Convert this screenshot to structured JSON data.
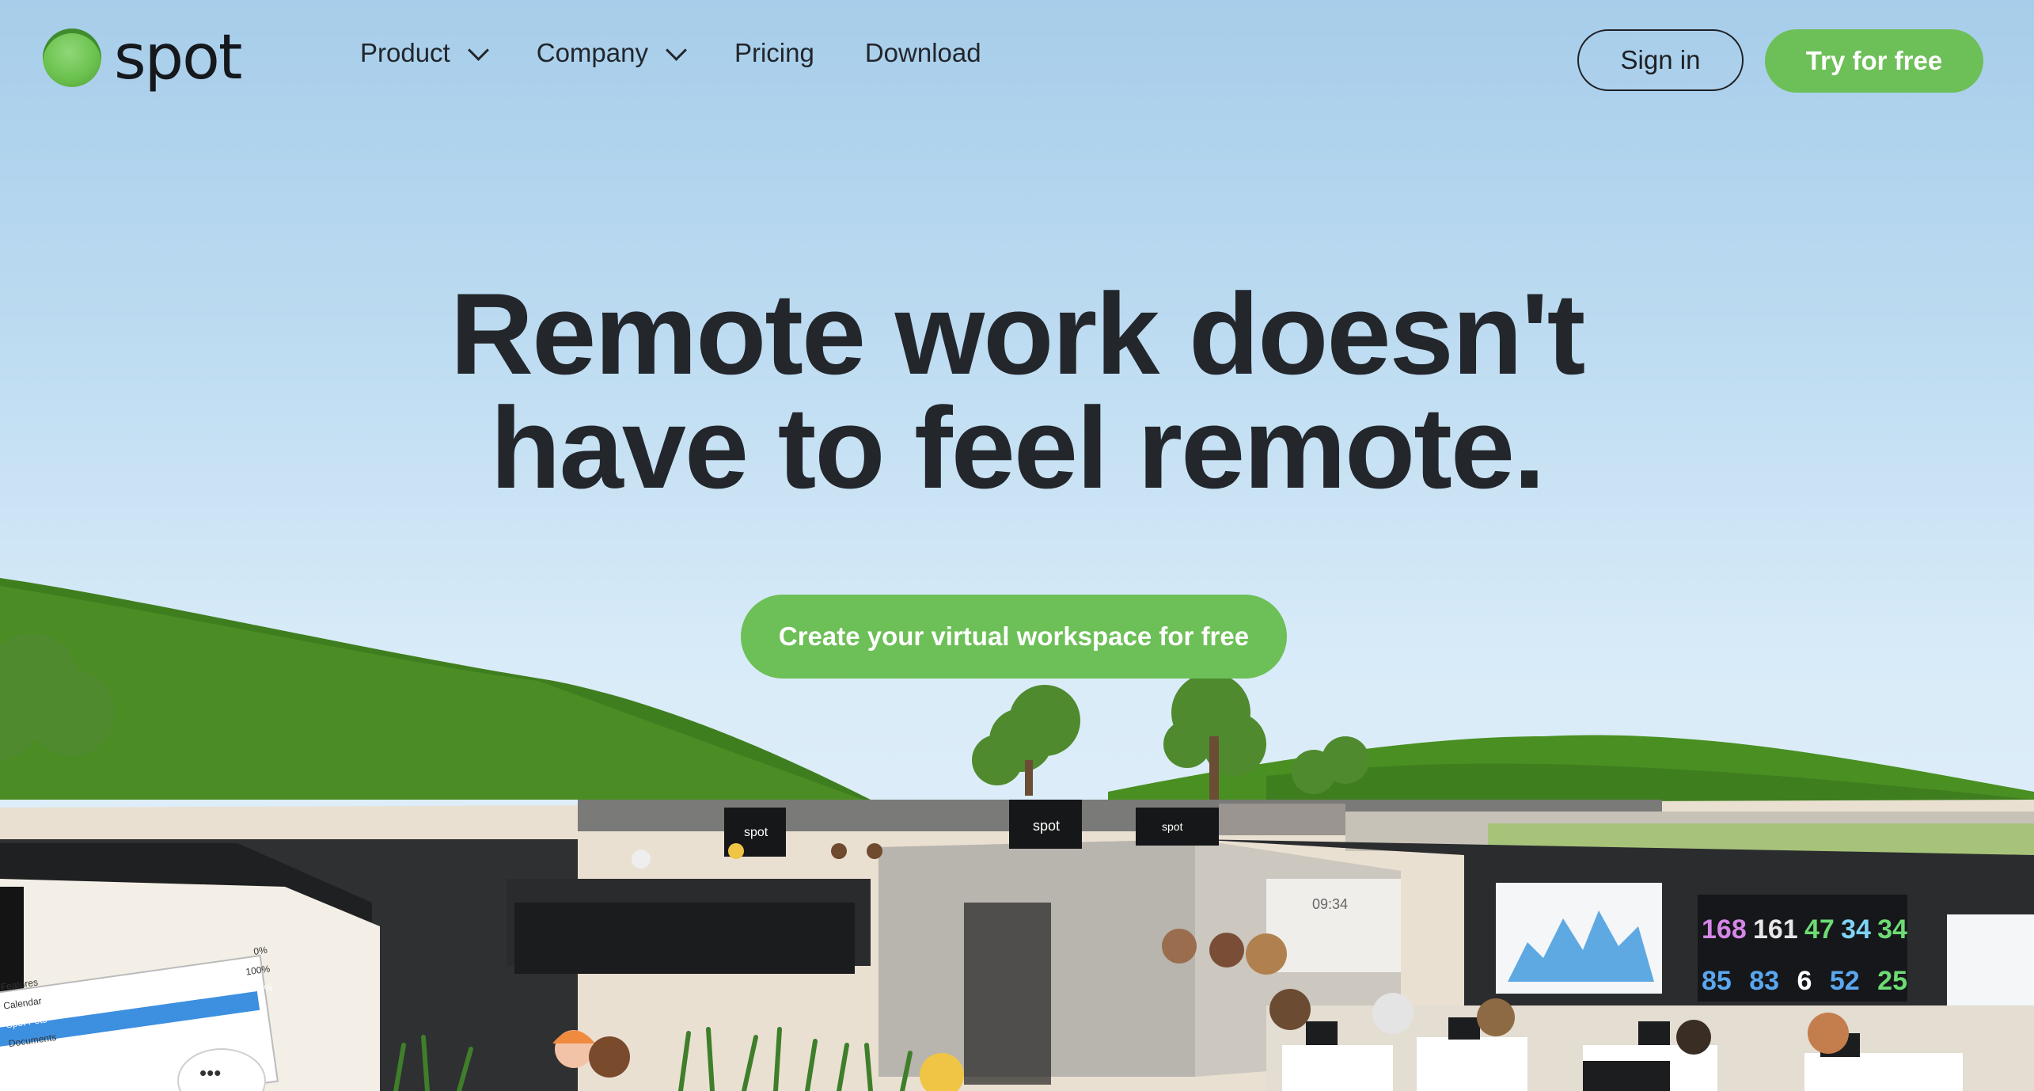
{
  "brand": {
    "name": "spot",
    "accent": "#6dbf57"
  },
  "nav": {
    "items": [
      {
        "label": "Product",
        "has_dropdown": true
      },
      {
        "label": "Company",
        "has_dropdown": true
      },
      {
        "label": "Pricing",
        "has_dropdown": false
      },
      {
        "label": "Download",
        "has_dropdown": false
      }
    ]
  },
  "header": {
    "signin_label": "Sign in",
    "try_label": "Try for free"
  },
  "hero": {
    "title_line1": "Remote work doesn't",
    "title_line2": "have to feel remote.",
    "cta_label": "Create your virtual workspace for free"
  },
  "scene": {
    "office_signs": [
      "spot",
      "spot",
      "spot"
    ],
    "clock": "09:34",
    "dashboard_numbers_top": [
      "168",
      "161",
      "47",
      "34",
      "34"
    ],
    "dashboard_numbers_bottom": [
      "85",
      "83",
      "6",
      "52",
      "25"
    ],
    "tablet_items": [
      {
        "label": "Features",
        "value": "0%"
      },
      {
        "label": "Calendar",
        "value": "100%"
      },
      {
        "label": "Spot Pets",
        "value": "0%"
      },
      {
        "label": "Documents",
        "value": ""
      }
    ],
    "chat_bubble": "•••"
  }
}
